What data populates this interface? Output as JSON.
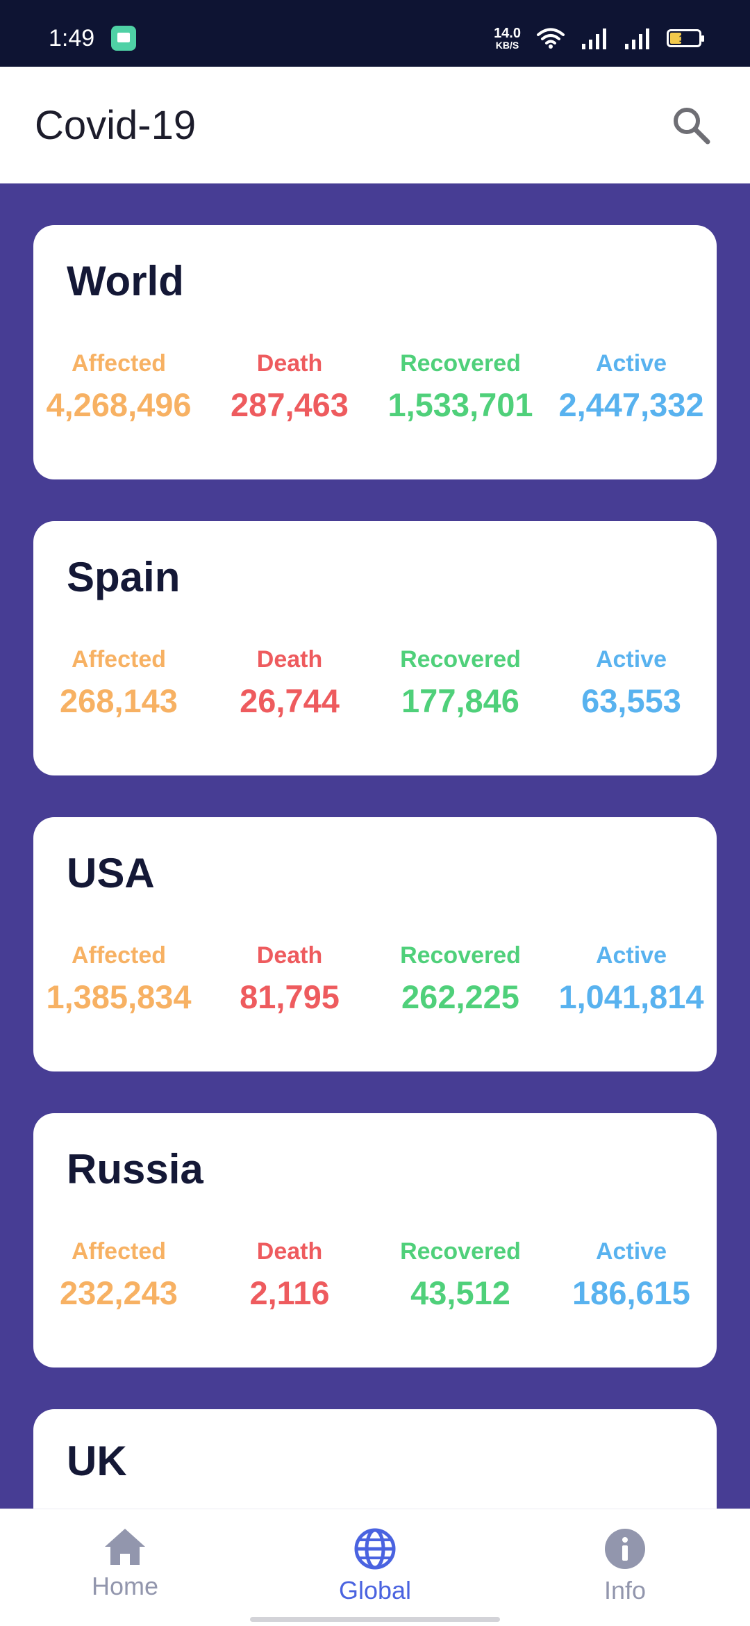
{
  "status_bar": {
    "time": "1:49",
    "net_speed_value": "14.0",
    "net_speed_unit": "KB/S",
    "battery_level": "11",
    "icons": [
      "messages-app-icon",
      "wifi-icon",
      "signal-icon",
      "signal-icon",
      "battery-icon"
    ]
  },
  "app_bar": {
    "title": "Covid-19",
    "search_icon": "search-icon"
  },
  "colors": {
    "background": "#473d94",
    "affected": "#f7b163",
    "death": "#ee5b5e",
    "recovered": "#4fd07a",
    "active": "#58b2ef",
    "nav_active": "#4a63e0",
    "nav_inactive": "#9296ad"
  },
  "labels": {
    "affected": "Affected",
    "death": "Death",
    "recovered": "Recovered",
    "active": "Active"
  },
  "cards": [
    {
      "name": "World",
      "affected": "4,268,496",
      "death": "287,463",
      "recovered": "1,533,701",
      "active": "2,447,332"
    },
    {
      "name": "Spain",
      "affected": "268,143",
      "death": "26,744",
      "recovered": "177,846",
      "active": "63,553"
    },
    {
      "name": "USA",
      "affected": "1,385,834",
      "death": "81,795",
      "recovered": "262,225",
      "active": "1,041,814"
    },
    {
      "name": "Russia",
      "affected": "232,243",
      "death": "2,116",
      "recovered": "43,512",
      "active": "186,615"
    },
    {
      "name": "UK"
    }
  ],
  "bottom_nav": {
    "items": [
      {
        "label": "Home",
        "icon": "home-icon"
      },
      {
        "label": "Global",
        "icon": "globe-icon",
        "selected": true
      },
      {
        "label": "Info",
        "icon": "info-icon"
      }
    ]
  }
}
